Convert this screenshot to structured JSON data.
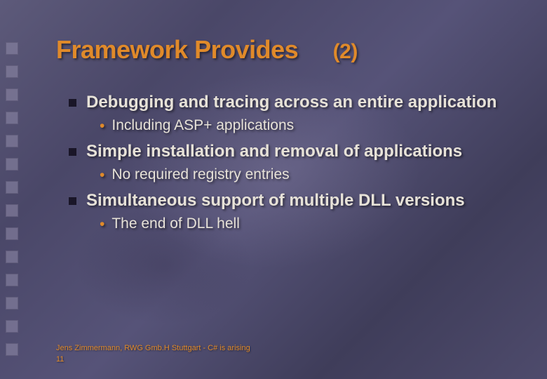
{
  "title_main": "Framework Provides",
  "title_num": "(2)",
  "bullets": [
    {
      "text": "Debugging and tracing across an entire application",
      "sub": [
        "Including ASP+ applications"
      ]
    },
    {
      "text": "Simple installation and removal of applications",
      "sub": [
        "No required registry entries"
      ]
    },
    {
      "text": "Simultaneous support of multiple DLL versions",
      "sub": [
        "The end of DLL hell"
      ]
    }
  ],
  "footer_text": "Jens Zimmermann, RWG Gmb.H Stuttgart - C# is arising",
  "footer_page": "11"
}
